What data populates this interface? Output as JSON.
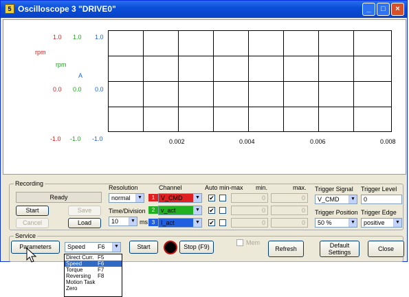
{
  "window": {
    "title": "Oscilloscope 3 \"DRIVE0\"",
    "app_icon": "5",
    "min": "_",
    "max": "□",
    "close": "×"
  },
  "scope": {
    "col1": {
      "top": "1.0",
      "unit": "rpm",
      "mid": "0.0",
      "bottom": "-1.0",
      "color": "#d02020"
    },
    "col2": {
      "top": "1.0",
      "unit": "rpm",
      "mid": "0.0",
      "bottom": "-1.0",
      "color": "#20a020"
    },
    "col3": {
      "top": "1.0",
      "unit": "A",
      "mid": "0.0",
      "bottom": "-1.0",
      "color": "#2060d0"
    },
    "x_ticks": [
      "0.002",
      "0.004",
      "0.006",
      "0.008"
    ]
  },
  "recording": {
    "group_label": "Recording",
    "status": "Ready",
    "start": "Start",
    "save": "Save",
    "cancel": "Cancel",
    "load": "Load",
    "resolution_label": "Resolution",
    "resolution_value": "normal",
    "time_div_label": "Time/Division",
    "time_div_value": "10",
    "time_div_unit": "ms",
    "channel_label": "Channel",
    "auto_label": "Auto",
    "minmax_label": "min-max",
    "min_label": "min.",
    "max_label": "max.",
    "channels": [
      {
        "num": "1",
        "name": "V_CMD",
        "color": "#e02020",
        "min": "0",
        "max": "0"
      },
      {
        "num": "2",
        "name": "v_act",
        "color": "#20b020",
        "min": "0",
        "max": "0"
      },
      {
        "num": "3",
        "name": "I_act",
        "color": "#2060e0",
        "min": "0",
        "max": "0"
      }
    ],
    "trigger_signal_label": "Trigger Signal",
    "trigger_signal_value": "V_CMD",
    "trigger_level_label": "Trigger Level",
    "trigger_level_value": "0",
    "trigger_position_label": "Trigger Position",
    "trigger_position_value": "50 %",
    "trigger_edge_label": "Trigger Edge",
    "trigger_edge_value": "positive",
    "check_mark": "✔"
  },
  "service": {
    "group_label": "Service",
    "parameters": "Parameters",
    "mode_value": "Speed",
    "mode_key": "F6",
    "start": "Start",
    "stop": "Stop (F9)",
    "mem": "Mem",
    "refresh": "Refresh",
    "default_l1": "Default",
    "default_l2": "Settings",
    "close": "Close"
  },
  "menu": [
    {
      "label": "Direct Curr.",
      "key": "F5"
    },
    {
      "label": "Speed",
      "key": "F6"
    },
    {
      "label": "Torque",
      "key": "F7"
    },
    {
      "label": "Reversing",
      "key": "F8"
    },
    {
      "label": "Motion Task",
      "key": ""
    },
    {
      "label": "Zero",
      "key": ""
    }
  ]
}
